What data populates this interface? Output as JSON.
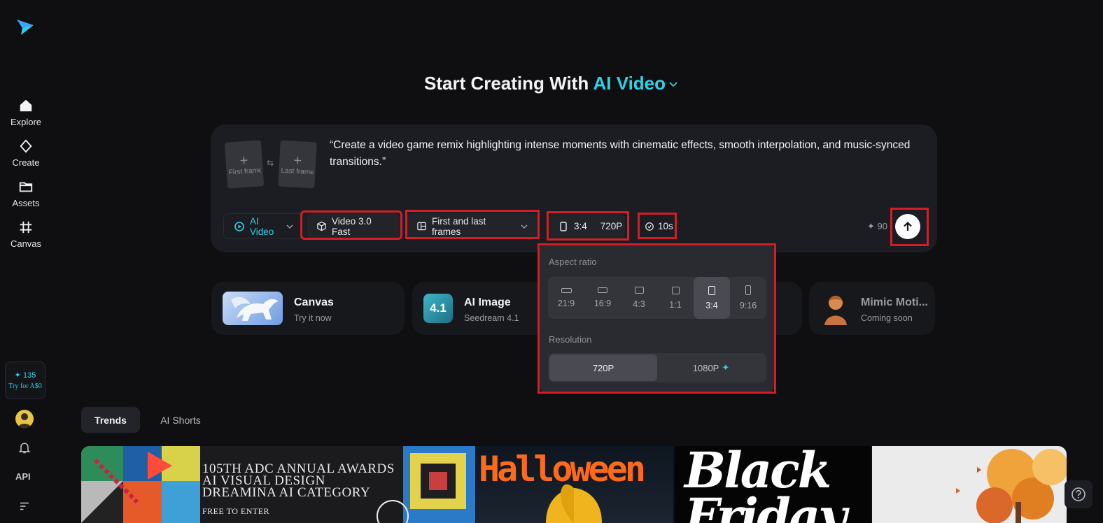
{
  "sidebar": {
    "items": [
      {
        "label": "Explore",
        "icon": "home-icon"
      },
      {
        "label": "Create",
        "icon": "diamond-icon"
      },
      {
        "label": "Assets",
        "icon": "folder-icon"
      },
      {
        "label": "Canvas",
        "icon": "frame-icon"
      }
    ],
    "credits": "135",
    "trial": "Try for A$0",
    "api_label": "API"
  },
  "heading": {
    "prefix": "Start Creating With",
    "accent": "AI Video"
  },
  "prompt": {
    "first_frame": "First frame",
    "last_frame": "Last frame",
    "text": "“Create a video game remix highlighting intense moments with cinematic effects, smooth interpolation, and music-synced transitions.”"
  },
  "toolbar": {
    "mode": "AI Video",
    "model": "Video 3.0 Fast",
    "frames": "First and last frames",
    "ratio": "3:4",
    "resolution": "720P",
    "duration": "10s",
    "cost": "90"
  },
  "features": [
    {
      "name": "Canvas",
      "sub": "Try it now"
    },
    {
      "name": "AI Image",
      "sub": "Seedream 4.1"
    },
    {
      "name": "Mimic Moti...",
      "sub": "Coming soon"
    }
  ],
  "popup": {
    "aspect_title": "Aspect ratio",
    "ratios": [
      "21:9",
      "16:9",
      "4:3",
      "1:1",
      "3:4",
      "9:16"
    ],
    "selected_ratio": "3:4",
    "resolution_title": "Resolution",
    "resolutions": [
      "720P",
      "1080P"
    ],
    "selected_resolution": "720P"
  },
  "tabs": [
    "Trends",
    "AI Shorts"
  ],
  "gallery": {
    "adc_lines": [
      "105TH ADC ANNUAL AWARDS",
      "AI VISUAL DESIGN",
      "DREAMINA AI CATEGORY",
      "FREE TO ENTER"
    ],
    "halloween": "Halloween",
    "black_friday": "Black Friday"
  },
  "colors": {
    "accent": "#2fd1e6",
    "highlight": "#d21e26",
    "background": "#0f0f11"
  }
}
